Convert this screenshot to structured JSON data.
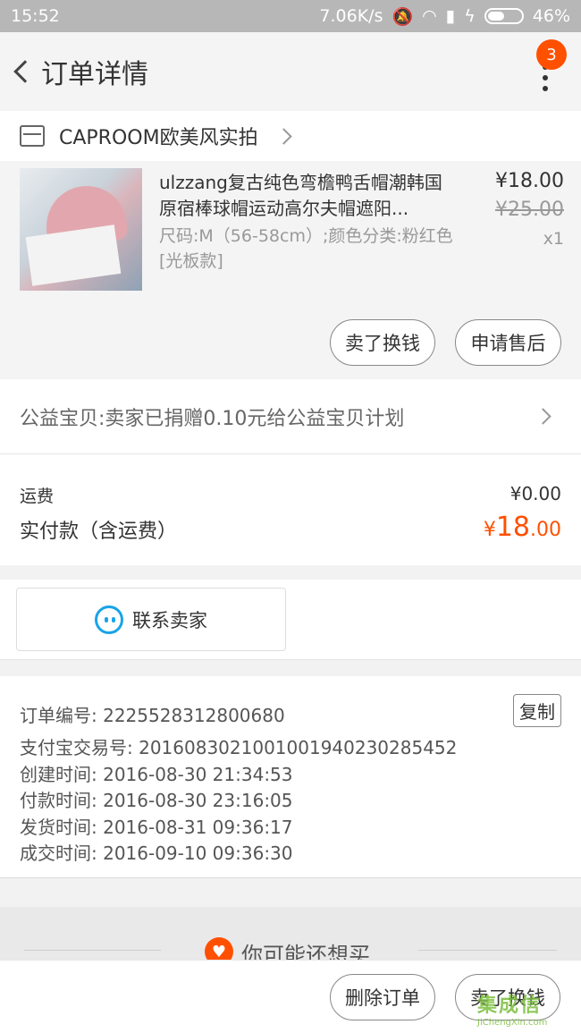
{
  "status_bar": {
    "time": "15:52",
    "speed": "7.06K/s",
    "battery": "46%"
  },
  "nav": {
    "title": "订单详情",
    "badge": "3"
  },
  "shop": {
    "name": "CAPROOM欧美风实拍"
  },
  "item": {
    "title": "ulzzang复古纯色弯檐鸭舌帽潮韩国原宿棒球帽运动高尔夫帽遮阳...",
    "sku": "尺码:M（56-58cm）;颜色分类:粉红色[光板款]",
    "price": "¥18.00",
    "original_price": "¥25.00",
    "quantity": "x1",
    "buttons": {
      "resell": "卖了换钱",
      "after_sale": "申请售后"
    }
  },
  "charity": {
    "text": "公益宝贝:卖家已捐赠0.10元给公益宝贝计划"
  },
  "fees": {
    "shipping_label": "运费",
    "shipping_value": "¥0.00",
    "paid_label": "实付款（含运费）",
    "paid_currency": "¥",
    "paid_integer": "18",
    "paid_decimal": ".00",
    "accent_color": "#ff5000"
  },
  "contact": {
    "label": "联系卖家"
  },
  "order_info": {
    "order_no": "订单编号: 2225528312800680",
    "copy_label": "复制",
    "alipay_no": "支付宝交易号: 2016083021001001940230285452",
    "created": "创建时间: 2016-08-30 21:34:53",
    "paid": "付款时间: 2016-08-30 23:16:05",
    "shipped": "发货时间: 2016-08-31 09:36:17",
    "completed": "成交时间: 2016-09-10 09:36:30"
  },
  "recommend": {
    "text": "你可能还想买"
  },
  "bottom_bar": {
    "delete": "删除订单",
    "resell": "卖了换钱"
  },
  "watermark": {
    "cn": "集成信",
    "en": "JiChengXin.com"
  }
}
